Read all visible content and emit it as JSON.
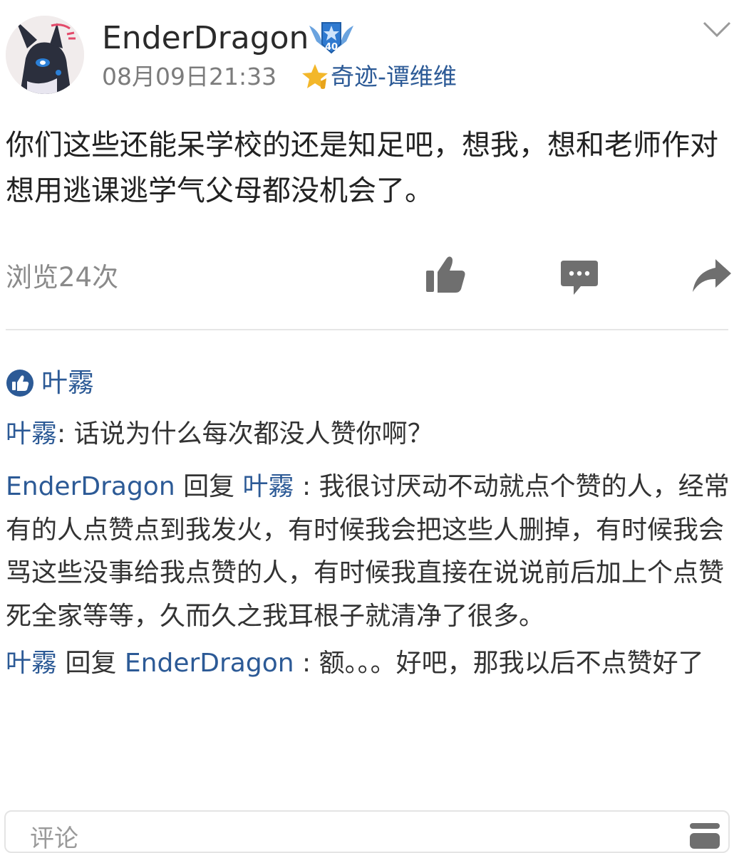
{
  "post": {
    "author": "EnderDragon",
    "time": "08月09日21:33",
    "group": "奇迹-谭维维",
    "level_badge": "40",
    "body": "你们这些还能呆学校的还是知足吧，想我，想和老师作对想用逃课逃学气父母都没机会了。",
    "views": "浏览24次"
  },
  "likes": {
    "names": "叶霧"
  },
  "comments": [
    {
      "user": "叶霧",
      "sep": ": ",
      "text": "话说为什么每次都没人赞你啊？"
    },
    {
      "user": "EnderDragon",
      "reply_word": " 回复 ",
      "target": "叶霧",
      "sep": " : ",
      "text": "我很讨厌动不动就点个赞的人，经常有的人点赞点到我发火，有时候我会把这些人删掉，有时候我会骂这些没事给我点赞的人，有时候我直接在说说前后加上个点赞死全家等等，久而久之我耳根子就清净了很多。"
    },
    {
      "user": "叶霧",
      "reply_word": " 回复 ",
      "target": "EnderDragon",
      "sep": " : ",
      "text": "额。。。好吧，那我以后不点赞好了"
    }
  ],
  "comment_input": {
    "placeholder": "评论"
  },
  "icons": {
    "expand": "chevron-down-icon",
    "like": "thumbs-up-icon",
    "comment": "comment-bubble-icon",
    "share": "share-arrow-icon",
    "liked_marker": "thumbs-up-circle-icon",
    "emoji": "emoji-icon"
  },
  "colors": {
    "link_blue": "#2c5a96",
    "icon_gray": "#6f6f6f",
    "muted_text": "#8a8a8a",
    "divider": "#e6e6e6"
  }
}
